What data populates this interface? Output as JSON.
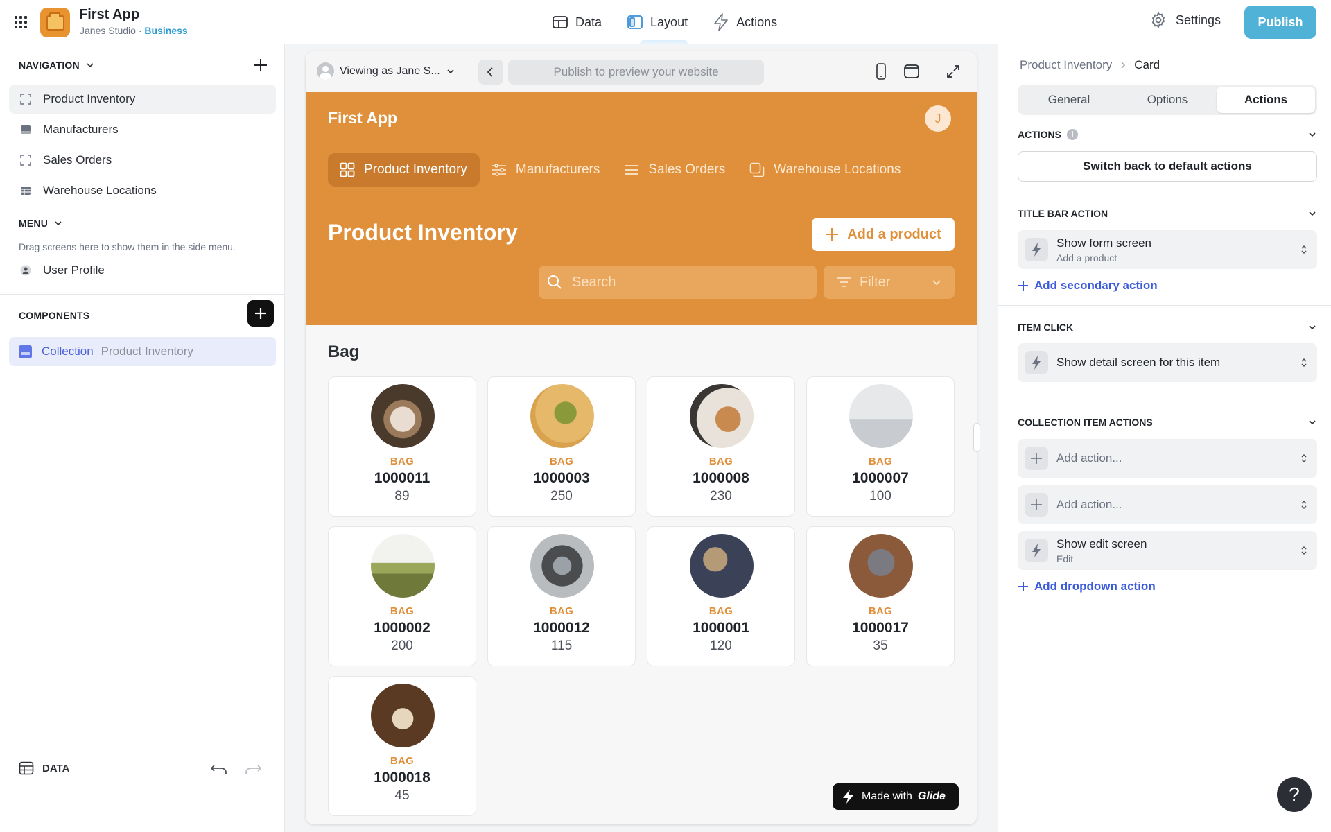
{
  "topbar": {
    "app_name": "First App",
    "studio": "Janes Studio",
    "separator": "·",
    "plan": "Business",
    "tabs": [
      {
        "label": "Data",
        "icon": "table-icon"
      },
      {
        "label": "Layout",
        "icon": "layout-icon",
        "active": true
      },
      {
        "label": "Actions",
        "icon": "bolt-icon"
      }
    ],
    "settings_label": "Settings",
    "publish_label": "Publish"
  },
  "left": {
    "navigation_label": "NAVIGATION",
    "nav_items": [
      {
        "label": "Product Inventory",
        "selected": true
      },
      {
        "label": "Manufacturers"
      },
      {
        "label": "Sales Orders"
      },
      {
        "label": "Warehouse Locations"
      }
    ],
    "menu_label": "MENU",
    "menu_hint": "Drag screens here to show them in the side menu.",
    "menu_items": [
      {
        "label": "User Profile"
      }
    ],
    "components_label": "COMPONENTS",
    "component": {
      "type": "Collection",
      "name": "Product Inventory"
    },
    "footer_label": "DATA"
  },
  "preview": {
    "viewing_as": "Viewing as Jane S...",
    "url_placeholder": "Publish to preview your website",
    "app_title": "First App",
    "user_initial": "J",
    "tabs": [
      {
        "label": "Product Inventory",
        "active": true
      },
      {
        "label": "Manufacturers"
      },
      {
        "label": "Sales Orders"
      },
      {
        "label": "Warehouse Locations"
      }
    ],
    "page_title": "Product Inventory",
    "add_button": "Add a product",
    "search_placeholder": "Search",
    "filter_label": "Filter",
    "group_title": "Bag",
    "items": [
      {
        "category": "BAG",
        "id": "1000011",
        "qty": "89"
      },
      {
        "category": "BAG",
        "id": "1000003",
        "qty": "250"
      },
      {
        "category": "BAG",
        "id": "1000008",
        "qty": "230"
      },
      {
        "category": "BAG",
        "id": "1000007",
        "qty": "100"
      },
      {
        "category": "BAG",
        "id": "1000002",
        "qty": "200"
      },
      {
        "category": "BAG",
        "id": "1000012",
        "qty": "115"
      },
      {
        "category": "BAG",
        "id": "1000001",
        "qty": "120"
      },
      {
        "category": "BAG",
        "id": "1000017",
        "qty": "35"
      },
      {
        "category": "BAG",
        "id": "1000018",
        "qty": "45"
      }
    ],
    "made_with": "Made with",
    "made_with_brand": "Glide"
  },
  "right": {
    "breadcrumb": [
      "Product Inventory",
      "Card"
    ],
    "tabs": [
      "General",
      "Options",
      "Actions"
    ],
    "active_tab": "Actions",
    "actions_label": "ACTIONS",
    "default_actions_button": "Switch back to default actions",
    "title_bar_label": "TITLE BAR ACTION",
    "title_bar_action": {
      "title": "Show form screen",
      "sub": "Add a product"
    },
    "add_secondary": "Add secondary action",
    "item_click_label": "ITEM CLICK",
    "item_click_action": {
      "title": "Show detail screen for this item"
    },
    "collection_actions_label": "COLLECTION ITEM ACTIONS",
    "collection_actions": [
      {
        "title": "Add action..."
      },
      {
        "title": "Add action..."
      },
      {
        "title": "Show edit screen",
        "sub": "Edit"
      }
    ],
    "add_dropdown": "Add dropdown action"
  },
  "colors": {
    "brand_orange": "#e0903a",
    "publish_blue": "#4fb2d6",
    "link_blue": "#3b5bdb",
    "plan_blue": "#2f9bd1"
  }
}
